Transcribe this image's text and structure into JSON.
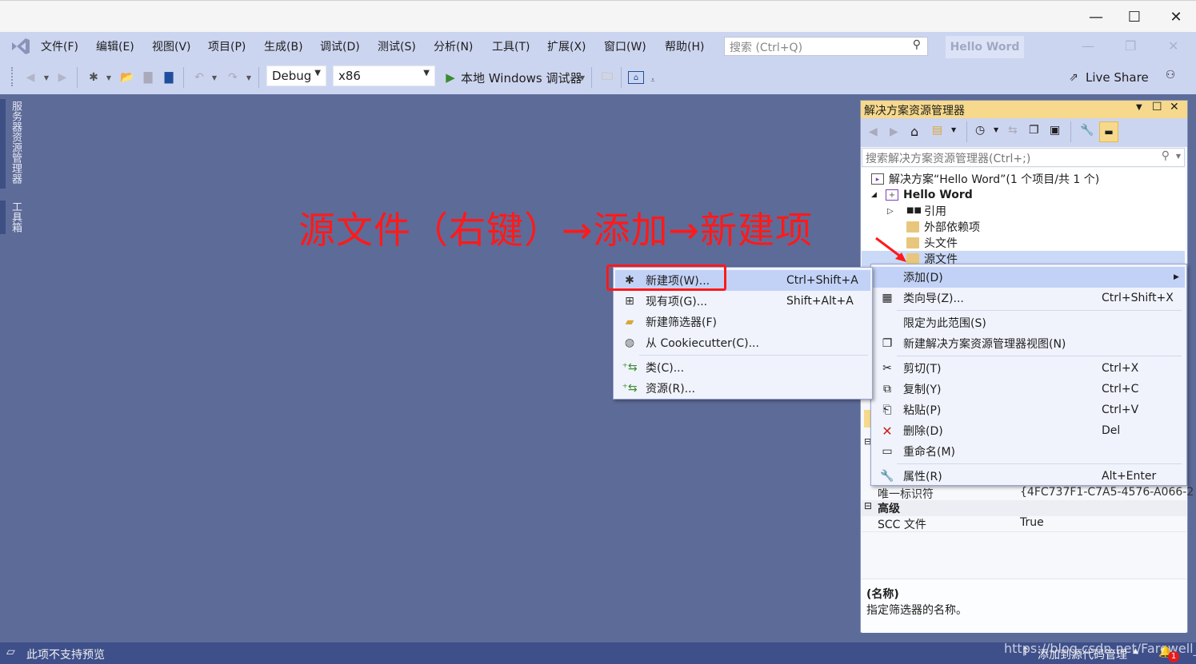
{
  "window": {
    "minimize_icon": "minimize-icon",
    "maximize_icon": "maximize-icon",
    "close_icon": "close-icon"
  },
  "menu": {
    "items": [
      "文件(F)",
      "编辑(E)",
      "视图(V)",
      "项目(P)",
      "生成(B)",
      "调试(D)",
      "测试(S)",
      "分析(N)",
      "工具(T)",
      "扩展(X)",
      "窗口(W)",
      "帮助(H)"
    ],
    "search_placeholder": "搜索 (Ctrl+Q)",
    "project_name": "Hello Word"
  },
  "toolbar": {
    "config": "Debug",
    "platform": "x86",
    "run_label": "本地 Windows 调试器",
    "live_share": "Live Share"
  },
  "side_tabs": [
    "服务器资源管理器",
    "工具箱"
  ],
  "annotation": "源文件（右键）→添加→新建项",
  "solution_explorer": {
    "title": "解决方案资源管理器",
    "search_placeholder": "搜索解决方案资源管理器(Ctrl+;)",
    "tree": [
      {
        "label": "解决方案“Hello Word”(1 个项目/共 1 个)",
        "level": 0,
        "bold": false
      },
      {
        "label": "Hello Word",
        "level": 1,
        "bold": true
      },
      {
        "label": "引用",
        "level": 2,
        "bold": false
      },
      {
        "label": "外部依赖项",
        "level": 2,
        "bold": false
      },
      {
        "label": "头文件",
        "level": 2,
        "bold": false
      },
      {
        "label": "源文件",
        "level": 2,
        "bold": false,
        "selected": true
      }
    ]
  },
  "properties": {
    "rows": [
      {
        "name": "唯一标识符",
        "value": "{4FC737F1-C7A5-4576-A066-2"
      }
    ],
    "section_advanced": "高级",
    "scc_row": {
      "name": "SCC 文件",
      "value": "True"
    },
    "desc_title": "(名称)",
    "desc_text": "指定筛选器的名称。"
  },
  "context_menu": {
    "items": [
      {
        "label": "添加(D)",
        "shortcut": "",
        "icon": "",
        "submenu": true,
        "highlighted": true
      },
      {
        "label": "类向导(Z)...",
        "shortcut": "Ctrl+Shift+X",
        "icon": "class-wizard-icon"
      },
      {
        "label": "限定为此范围(S)",
        "shortcut": "",
        "icon": ""
      },
      {
        "label": "新建解决方案资源管理器视图(N)",
        "shortcut": "",
        "icon": "new-view-icon"
      },
      {
        "label": "剪切(T)",
        "shortcut": "Ctrl+X",
        "icon": "cut-icon"
      },
      {
        "label": "复制(Y)",
        "shortcut": "Ctrl+C",
        "icon": "copy-icon"
      },
      {
        "label": "粘贴(P)",
        "shortcut": "Ctrl+V",
        "icon": "paste-icon"
      },
      {
        "label": "删除(D)",
        "shortcut": "Del",
        "icon": "delete-icon"
      },
      {
        "label": "重命名(M)",
        "shortcut": "",
        "icon": "rename-icon"
      },
      {
        "label": "属性(R)",
        "shortcut": "Alt+Enter",
        "icon": "wrench-icon"
      }
    ]
  },
  "add_submenu": {
    "items": [
      {
        "label": "新建项(W)...",
        "shortcut": "Ctrl+Shift+A",
        "highlighted": true
      },
      {
        "label": "现有项(G)...",
        "shortcut": "Shift+Alt+A"
      },
      {
        "label": "新建筛选器(F)",
        "shortcut": ""
      },
      {
        "label": "从 Cookiecutter(C)...",
        "shortcut": ""
      },
      {
        "label": "类(C)...",
        "shortcut": ""
      },
      {
        "label": "资源(R)...",
        "shortcut": ""
      }
    ]
  },
  "status": {
    "left": "此项不支持预览",
    "source_control": "添加到源代码管理",
    "notification_count": "1",
    "watermark": "https://blog.csdn.net/Farewell_w"
  },
  "colors": {
    "background": "#5d6b99",
    "chrome": "#ccd5f0",
    "panel_title": "#f6d98c",
    "status": "#3e4f8a",
    "annotation": "#ff1a1a",
    "menu_highlight": "#c2d2f7"
  }
}
